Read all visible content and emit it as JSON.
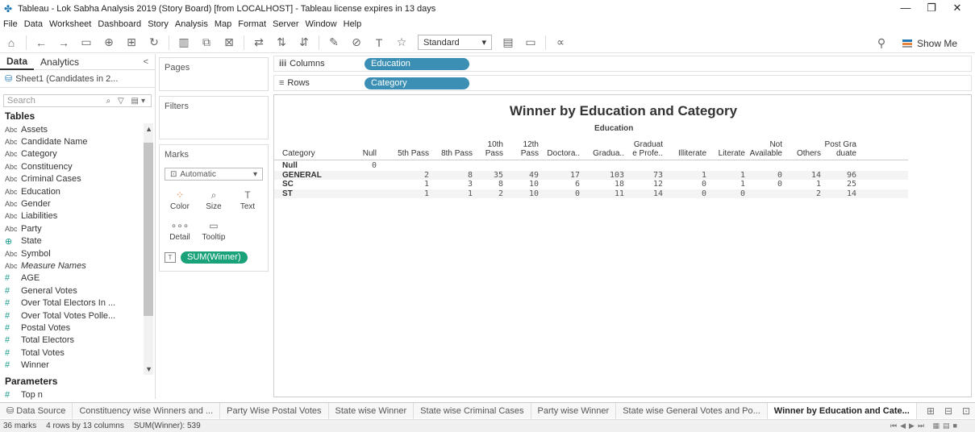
{
  "window": {
    "title": "Tableau - Lok Sabha Analysis 2019 (Story Board) [from LOCALHOST] - Tableau license expires in 13 days",
    "minimize": "—",
    "maximize": "❐",
    "close": "✕"
  },
  "menu": [
    "File",
    "Data",
    "Worksheet",
    "Dashboard",
    "Story",
    "Analysis",
    "Map",
    "Format",
    "Server",
    "Window",
    "Help"
  ],
  "toolbar": {
    "fit_select": "Standard",
    "show_me": "Show Me"
  },
  "left_pane": {
    "tab_data": "Data",
    "tab_analytics": "Analytics",
    "collapse": "<",
    "datasource": "Sheet1 (Candidates in 2...",
    "search_placeholder": "Search",
    "tables_heading": "Tables",
    "fields": [
      {
        "type": "Abc",
        "name": "Assets"
      },
      {
        "type": "Abc",
        "name": "Candidate Name"
      },
      {
        "type": "Abc",
        "name": "Category"
      },
      {
        "type": "Abc",
        "name": "Constituency"
      },
      {
        "type": "Abc",
        "name": "Criminal Cases"
      },
      {
        "type": "Abc",
        "name": "Education"
      },
      {
        "type": "Abc",
        "name": "Gender"
      },
      {
        "type": "Abc",
        "name": "Liabilities"
      },
      {
        "type": "Abc",
        "name": "Party"
      },
      {
        "type": "⊕",
        "name": "State"
      },
      {
        "type": "Abc",
        "name": "Symbol"
      },
      {
        "type": "Abc",
        "name": "Measure Names"
      },
      {
        "type": "#",
        "name": "AGE"
      },
      {
        "type": "#",
        "name": "General Votes"
      },
      {
        "type": "#",
        "name": "Over Total Electors In ..."
      },
      {
        "type": "#",
        "name": "Over Total Votes Polle..."
      },
      {
        "type": "#",
        "name": "Postal Votes"
      },
      {
        "type": "#",
        "name": "Total Electors"
      },
      {
        "type": "#",
        "name": "Total Votes"
      },
      {
        "type": "#",
        "name": "Winner"
      }
    ],
    "parameters_heading": "Parameters",
    "parameters": [
      {
        "type": "#",
        "name": "Top n"
      }
    ]
  },
  "cards": {
    "pages": "Pages",
    "filters": "Filters",
    "marks": "Marks",
    "mark_type": "Automatic",
    "buttons": [
      {
        "icon": "⁘",
        "label": "Color"
      },
      {
        "icon": "⌕",
        "label": "Size"
      },
      {
        "icon": "T",
        "label": "Text"
      },
      {
        "icon": "∘∘∘",
        "label": "Detail"
      },
      {
        "icon": "▭",
        "label": "Tooltip"
      }
    ],
    "text_pill": "SUM(Winner)"
  },
  "shelves": {
    "columns_label": "Columns",
    "columns_pill": "Education",
    "rows_label": "Rows",
    "rows_pill": "Category"
  },
  "viz": {
    "title": "Winner by Education and Category",
    "column_group": "Education",
    "row_header": "Category",
    "columns": [
      [
        "",
        "Null"
      ],
      [
        "",
        "5th Pass"
      ],
      [
        "",
        "8th Pass"
      ],
      [
        "10th",
        "Pass"
      ],
      [
        "12th",
        "Pass"
      ],
      [
        "",
        "Doctora.."
      ],
      [
        "",
        "Gradua.."
      ],
      [
        "Graduat",
        "e Profe.."
      ],
      [
        "",
        "Illiterate"
      ],
      [
        "",
        "Literate"
      ],
      [
        "Not",
        "Available"
      ],
      [
        "",
        "Others"
      ],
      [
        "Post Gra",
        "duate"
      ]
    ],
    "rows": [
      {
        "label": "Null",
        "values": [
          "0",
          "",
          "",
          "",
          "",
          "",
          "",
          "",
          "",
          "",
          "",
          "",
          ""
        ]
      },
      {
        "label": "GENERAL",
        "values": [
          "",
          "2",
          "8",
          "35",
          "49",
          "17",
          "103",
          "73",
          "1",
          "1",
          "0",
          "14",
          "96"
        ]
      },
      {
        "label": "SC",
        "values": [
          "",
          "1",
          "3",
          "8",
          "10",
          "6",
          "18",
          "12",
          "0",
          "1",
          "0",
          "1",
          "25"
        ]
      },
      {
        "label": "ST",
        "values": [
          "",
          "1",
          "1",
          "2",
          "10",
          "0",
          "11",
          "14",
          "0",
          "0",
          "",
          "2",
          "14"
        ]
      }
    ]
  },
  "sheet_tabs": [
    {
      "label": "Data Source",
      "active": false
    },
    {
      "label": "Constituency wise Winners and ...",
      "active": false
    },
    {
      "label": "Party Wise Postal Votes",
      "active": false
    },
    {
      "label": "State wise Winner",
      "active": false
    },
    {
      "label": "State wise Criminal Cases",
      "active": false
    },
    {
      "label": "Party wise Winner",
      "active": false
    },
    {
      "label": "State wise General Votes and Po...",
      "active": false
    },
    {
      "label": "Winner by Education and Cate...",
      "active": true
    }
  ],
  "status": {
    "marks": "36 marks",
    "dims": "4 rows by 13 columns",
    "sum": "SUM(Winner): 539"
  }
}
